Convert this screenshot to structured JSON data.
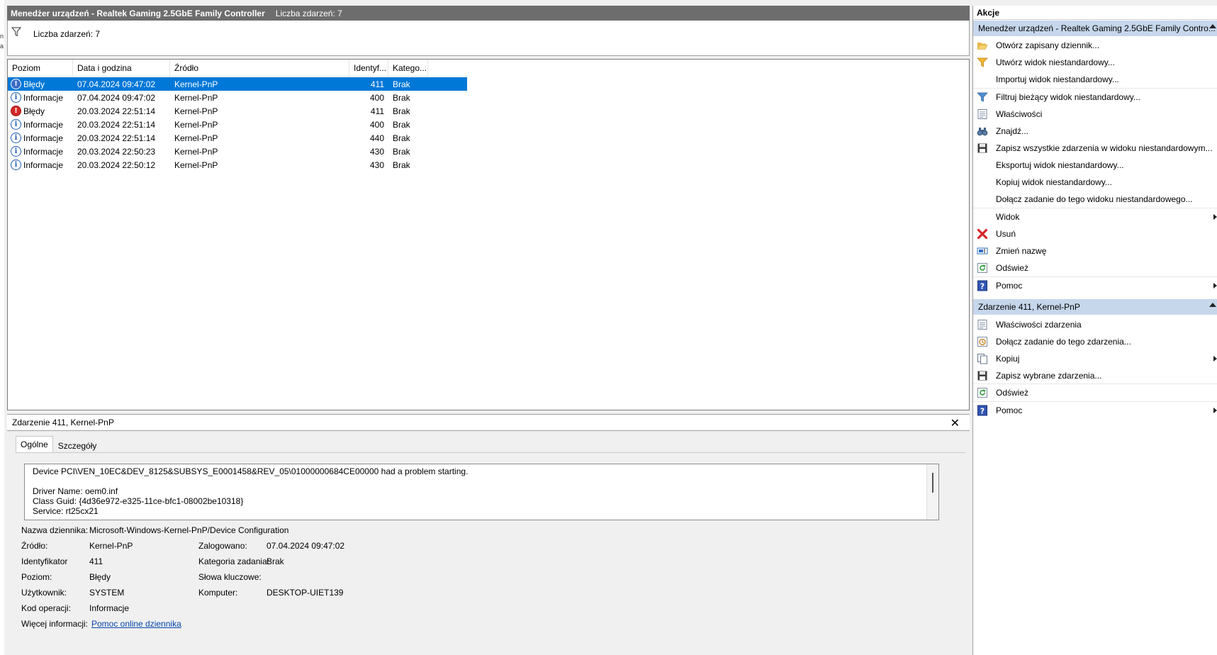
{
  "window": {
    "title": "Menedżer urządzeń - Realtek Gaming 2.5GbE Family Controller",
    "event_count_label": "Liczba zdarzeń: 7"
  },
  "filter": {
    "label": "Liczba zdarzeń: 7"
  },
  "grid": {
    "columns": [
      "Poziom",
      "Data i godzina",
      "Źródło",
      "Identyf...",
      "Katego..."
    ],
    "rows": [
      {
        "icon": "error",
        "level": "Błędy",
        "datetime": "07.04.2024 09:47:02",
        "source": "Kernel-PnP",
        "id": "411",
        "category": "Brak",
        "selected": true
      },
      {
        "icon": "info",
        "level": "Informacje",
        "datetime": "07.04.2024 09:47:02",
        "source": "Kernel-PnP",
        "id": "400",
        "category": "Brak"
      },
      {
        "icon": "error",
        "level": "Błędy",
        "datetime": "20.03.2024 22:51:14",
        "source": "Kernel-PnP",
        "id": "411",
        "category": "Brak"
      },
      {
        "icon": "info",
        "level": "Informacje",
        "datetime": "20.03.2024 22:51:14",
        "source": "Kernel-PnP",
        "id": "400",
        "category": "Brak"
      },
      {
        "icon": "info",
        "level": "Informacje",
        "datetime": "20.03.2024 22:51:14",
        "source": "Kernel-PnP",
        "id": "440",
        "category": "Brak"
      },
      {
        "icon": "info",
        "level": "Informacje",
        "datetime": "20.03.2024 22:50:23",
        "source": "Kernel-PnP",
        "id": "430",
        "category": "Brak"
      },
      {
        "icon": "info",
        "level": "Informacje",
        "datetime": "20.03.2024 22:50:12",
        "source": "Kernel-PnP",
        "id": "430",
        "category": "Brak"
      }
    ]
  },
  "detail": {
    "title": "Zdarzenie 411, Kernel-PnP",
    "tabs": [
      "Ogólne",
      "Szczegóły"
    ],
    "message": [
      "Device PCI\\VEN_10EC&DEV_8125&SUBSYS_E0001458&REV_05\\01000000684CE00000 had a problem starting.",
      "",
      "Driver Name: oem0.inf",
      "Class Guid: {4d36e972-e325-11ce-bfc1-08002be10318}",
      "Service: rt25cx21"
    ],
    "log_name_label": "Nazwa dziennika:",
    "log_name": "Microsoft-Windows-Kernel-PnP/Device Configuration",
    "source_label": "Źródło:",
    "source": "Kernel-PnP",
    "logged_label": "Zalogowano:",
    "logged": "07.04.2024 09:47:02",
    "id_label": "Identyfikator",
    "id": "411",
    "task_label": "Kategoria zadania:",
    "task": "Brak",
    "level_label": "Poziom:",
    "level": "Błędy",
    "keywords_label": "Słowa kluczowe:",
    "keywords": "",
    "user_label": "Użytkownik:",
    "user": "SYSTEM",
    "computer_label": "Komputer:",
    "computer": "DESKTOP-UIET139",
    "opcode_label": "Kod operacji:",
    "opcode": "Informacje",
    "more_label": "Więcej informacji:",
    "more_link": "Pomoc online dziennika"
  },
  "actions": {
    "header": "Akcje",
    "section1": {
      "title": "Menedżer urządzeń - Realtek Gaming 2.5GbE Family Contro...",
      "items": [
        {
          "label": "Otwórz zapisany dziennik...",
          "icon": "folder-open-icon"
        },
        {
          "label": "Utwórz widok niestandardowy...",
          "icon": "filter-create-icon"
        },
        {
          "label": "Importuj widok niestandardowy...",
          "icon": ""
        },
        {
          "label": "Filtruj bieżący widok niestandardowy...",
          "icon": "filter-icon"
        },
        {
          "label": "Właściwości",
          "icon": "properties-icon"
        },
        {
          "label": "Znajdź...",
          "icon": "binoculars-icon"
        },
        {
          "label": "Zapisz wszystkie zdarzenia w widoku niestandardowym...",
          "icon": "save-icon"
        },
        {
          "label": "Eksportuj widok niestandardowy...",
          "icon": ""
        },
        {
          "label": "Kopiuj widok niestandardowy...",
          "icon": ""
        },
        {
          "label": "Dołącz zadanie do tego widoku niestandardowego...",
          "icon": ""
        },
        {
          "label": "Widok",
          "icon": "",
          "submenu": true
        },
        {
          "label": "Usuń",
          "icon": "delete-icon"
        },
        {
          "label": "Zmień nazwę",
          "icon": "rename-icon"
        },
        {
          "label": "Odśwież",
          "icon": "refresh-icon"
        },
        {
          "label": "Pomoc",
          "icon": "help-icon",
          "submenu": true
        }
      ]
    },
    "section2": {
      "title": "Zdarzenie 411, Kernel-PnP",
      "items": [
        {
          "label": "Właściwości zdarzenia",
          "icon": "properties-icon"
        },
        {
          "label": "Dołącz zadanie do tego zdarzenia...",
          "icon": "task-icon"
        },
        {
          "label": "Kopiuj",
          "icon": "copy-icon",
          "submenu": true
        },
        {
          "label": "Zapisz wybrane zdarzenia...",
          "icon": "save-icon"
        },
        {
          "label": "Odśwież",
          "icon": "refresh-icon"
        },
        {
          "label": "Pomoc",
          "icon": "help-icon",
          "submenu": true
        }
      ]
    }
  }
}
